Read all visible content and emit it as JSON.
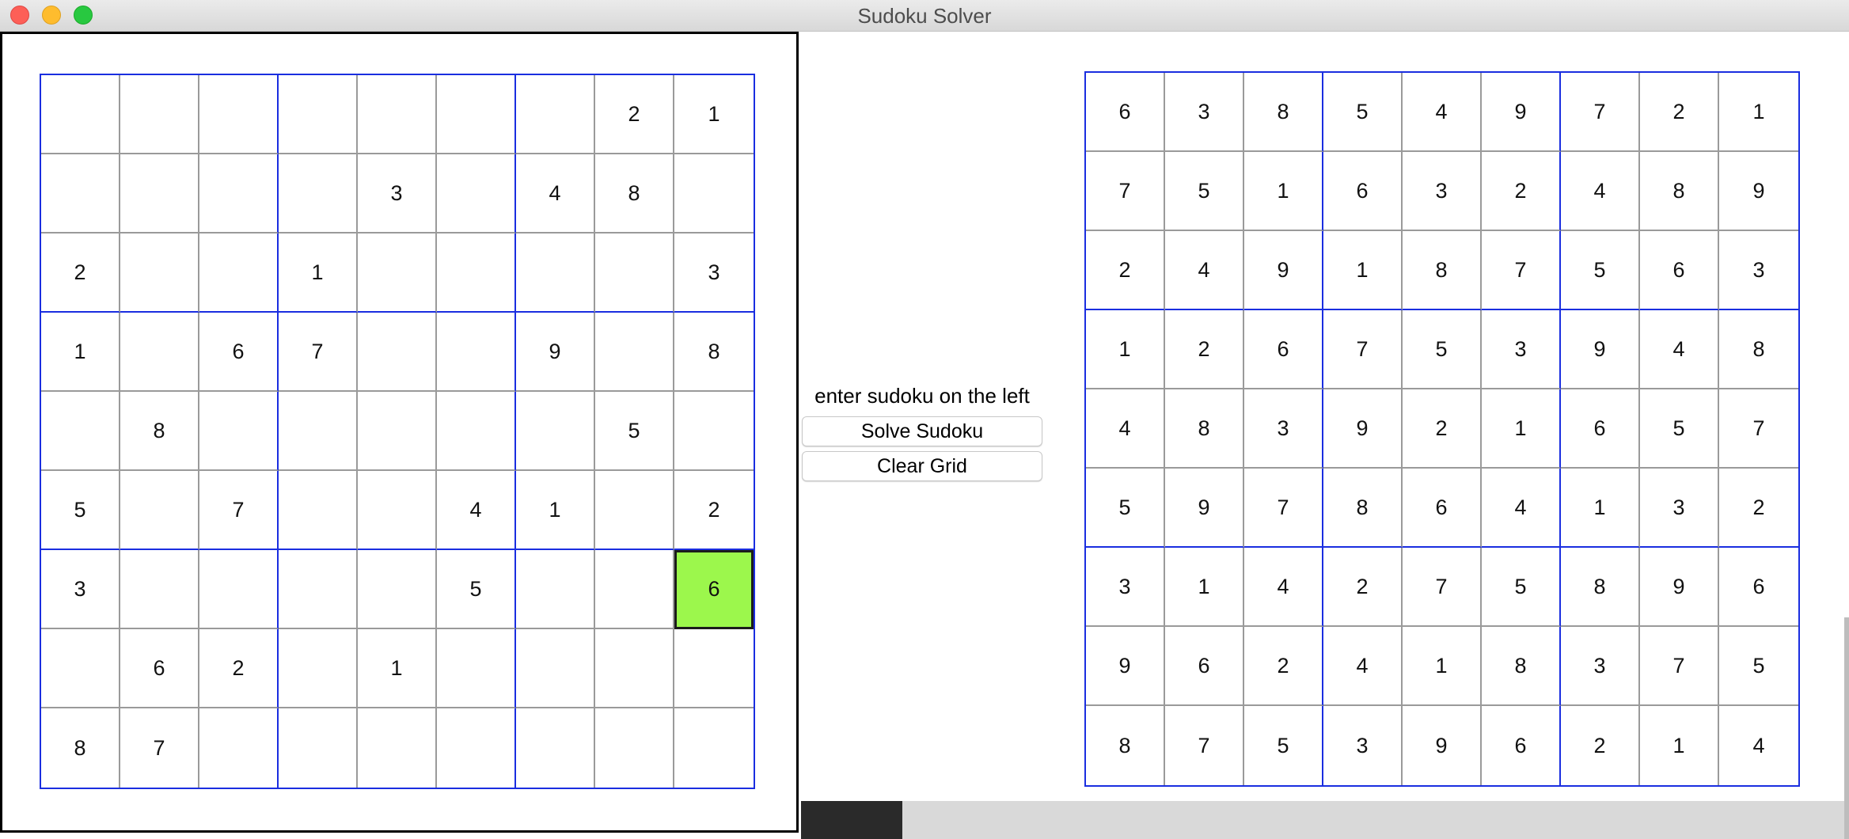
{
  "window": {
    "title": "Sudoku Solver"
  },
  "controls": {
    "hint": "enter sudoku on the left",
    "solve_label": "Solve Sudoku",
    "clear_label": "Clear Grid"
  },
  "input_grid": {
    "selected": {
      "row": 6,
      "col": 8
    },
    "selected_color": "#9cf74c",
    "rows": [
      [
        "",
        "",
        "",
        "",
        "",
        "",
        "",
        "2",
        "1"
      ],
      [
        "",
        "",
        "",
        "",
        "3",
        "",
        "4",
        "8",
        ""
      ],
      [
        "2",
        "",
        "",
        "1",
        "",
        "",
        "",
        "",
        "3"
      ],
      [
        "1",
        "",
        "6",
        "7",
        "",
        "",
        "9",
        "",
        "8"
      ],
      [
        "",
        "8",
        "",
        "",
        "",
        "",
        "",
        "5",
        ""
      ],
      [
        "5",
        "",
        "7",
        "",
        "",
        "4",
        "1",
        "",
        "2"
      ],
      [
        "3",
        "",
        "",
        "",
        "",
        "5",
        "",
        "",
        "6"
      ],
      [
        "",
        "6",
        "2",
        "",
        "1",
        "",
        "",
        "",
        ""
      ],
      [
        "8",
        "7",
        "",
        "",
        "",
        "",
        "",
        "",
        ""
      ]
    ]
  },
  "solution_grid": {
    "rows": [
      [
        "6",
        "3",
        "8",
        "5",
        "4",
        "9",
        "7",
        "2",
        "1"
      ],
      [
        "7",
        "5",
        "1",
        "6",
        "3",
        "2",
        "4",
        "8",
        "9"
      ],
      [
        "2",
        "4",
        "9",
        "1",
        "8",
        "7",
        "5",
        "6",
        "3"
      ],
      [
        "1",
        "2",
        "6",
        "7",
        "5",
        "3",
        "9",
        "4",
        "8"
      ],
      [
        "4",
        "8",
        "3",
        "9",
        "2",
        "1",
        "6",
        "5",
        "7"
      ],
      [
        "5",
        "9",
        "7",
        "8",
        "6",
        "4",
        "1",
        "3",
        "2"
      ],
      [
        "3",
        "1",
        "4",
        "2",
        "7",
        "5",
        "8",
        "9",
        "6"
      ],
      [
        "9",
        "6",
        "2",
        "4",
        "1",
        "8",
        "3",
        "7",
        "5"
      ],
      [
        "8",
        "7",
        "5",
        "3",
        "9",
        "6",
        "2",
        "1",
        "4"
      ]
    ]
  },
  "colors": {
    "box_border": "#1a2ee0",
    "cell_border": "#9a9a9a"
  }
}
